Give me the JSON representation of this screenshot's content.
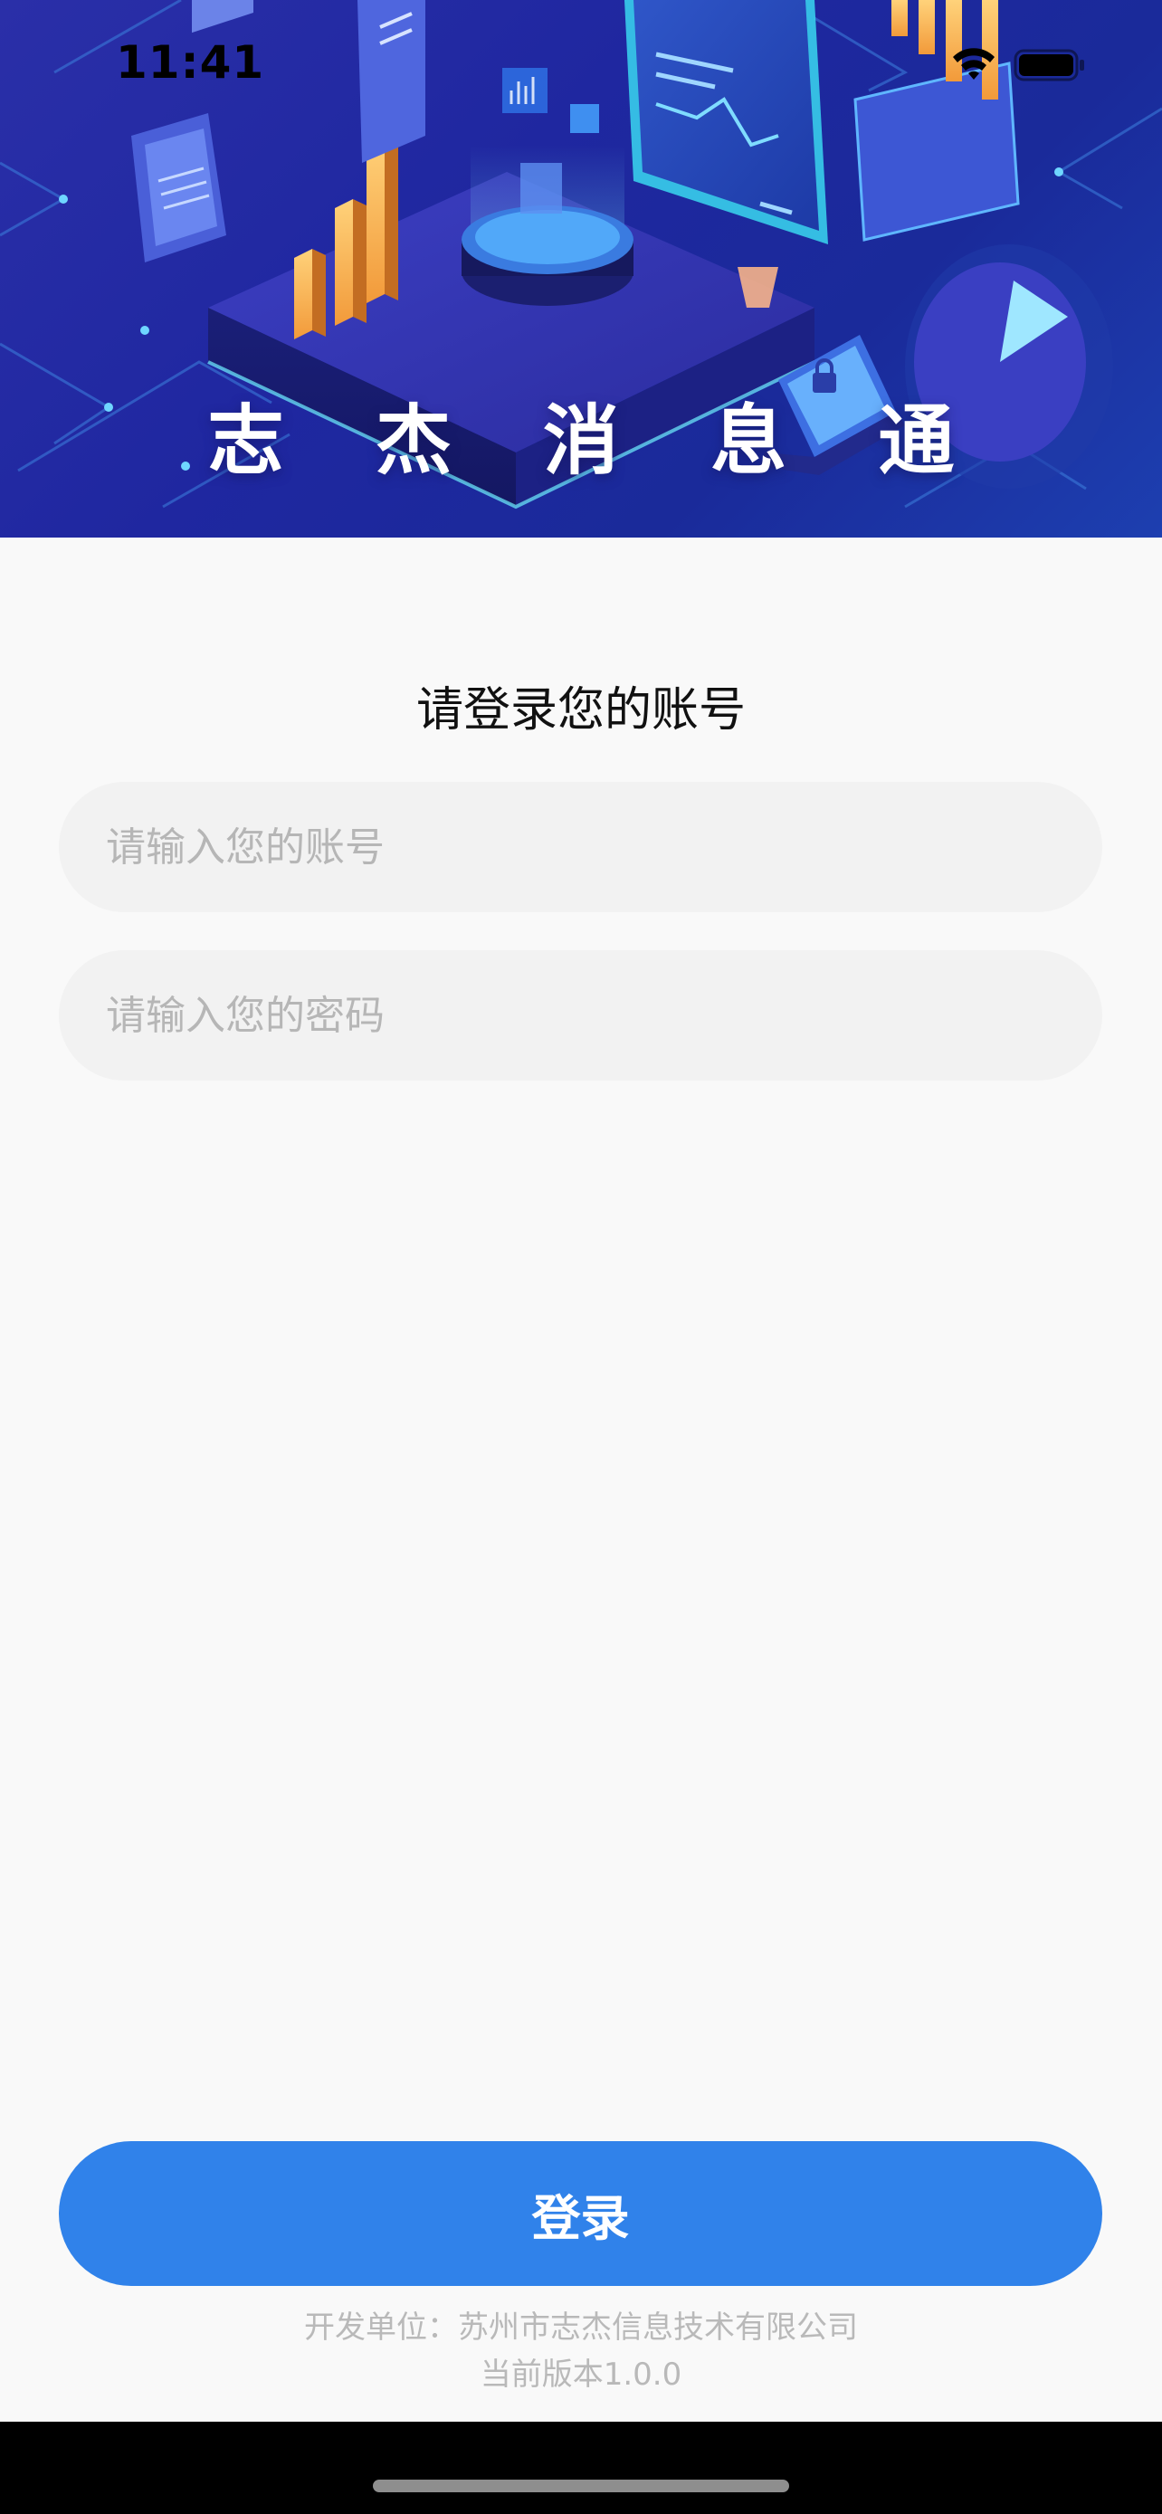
{
  "status_bar": {
    "time": "11:41"
  },
  "hero": {
    "title": "志 杰 消 息 通"
  },
  "login": {
    "heading": "请登录您的账号",
    "account_placeholder": "请输入您的账号",
    "account_value": "",
    "password_placeholder": "请输入您的密码",
    "password_value": "",
    "button_label": "登录"
  },
  "footer": {
    "developer": "开发单位：苏州市志杰信息技术有限公司",
    "version": "当前版本1.0.0"
  },
  "colors": {
    "primary": "#3082ea",
    "hero_background": "#2a2fa8",
    "input_background": "#f2f2f2",
    "placeholder": "#b6b6b6",
    "footer_text": "#b9b9b9"
  },
  "icons": [
    "wifi-icon",
    "battery-icon"
  ]
}
